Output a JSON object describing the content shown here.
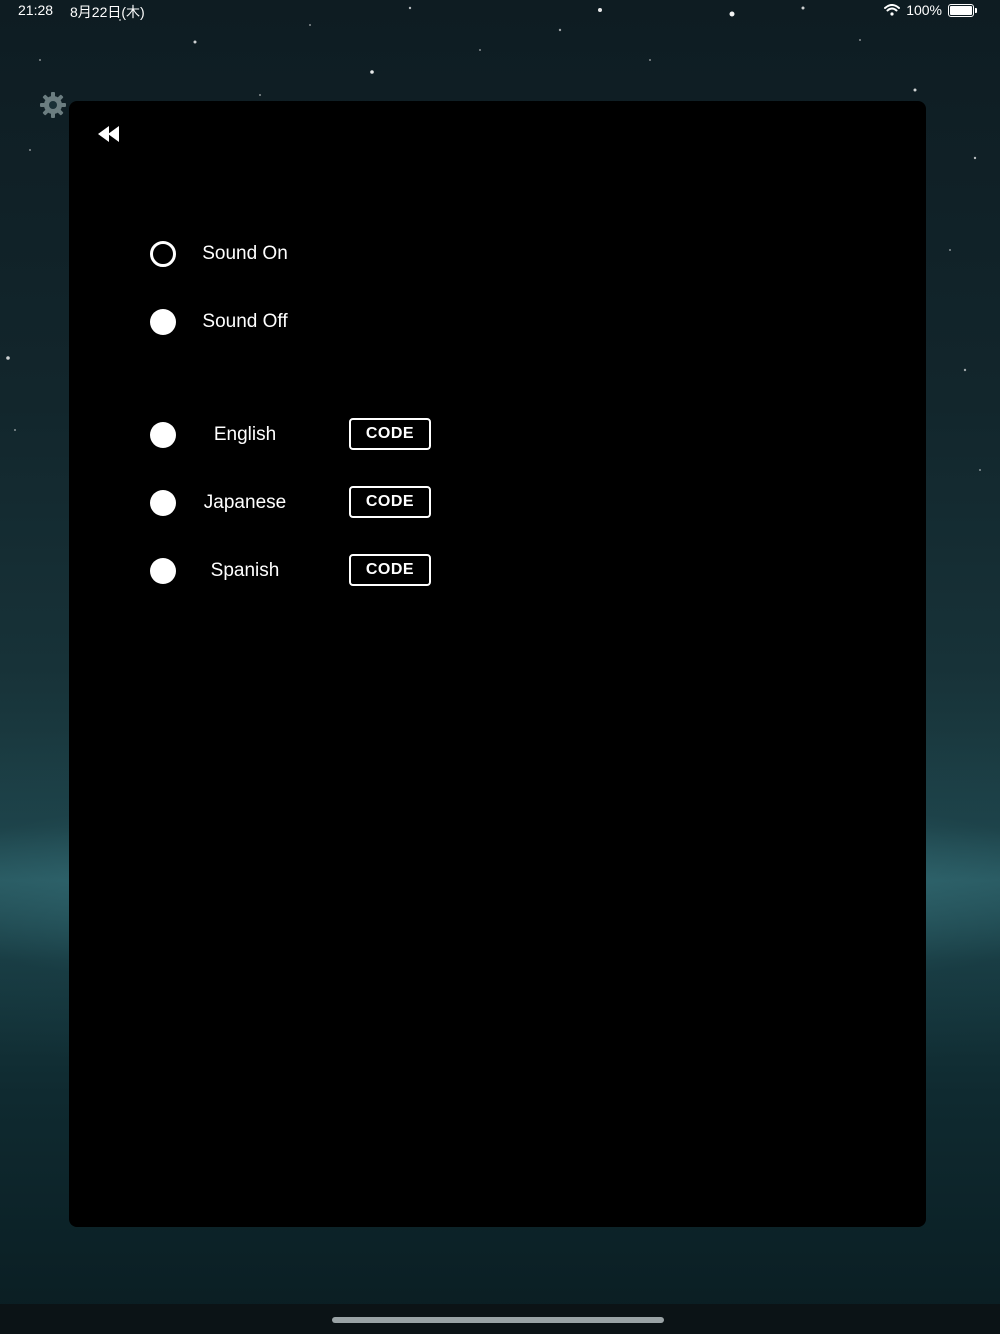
{
  "status_bar": {
    "time": "21:28",
    "date": "8月22日(木)",
    "battery": "100%"
  },
  "settings": {
    "sound": [
      {
        "label": "Sound On",
        "selected": true
      },
      {
        "label": "Sound Off",
        "selected": false
      }
    ],
    "languages": [
      {
        "label": "English",
        "code_button": "CODE"
      },
      {
        "label": "Japanese",
        "code_button": "CODE"
      },
      {
        "label": "Spanish",
        "code_button": "CODE"
      }
    ]
  },
  "icons": [
    "gear-icon",
    "back-icon",
    "wifi-icon",
    "battery-icon"
  ]
}
